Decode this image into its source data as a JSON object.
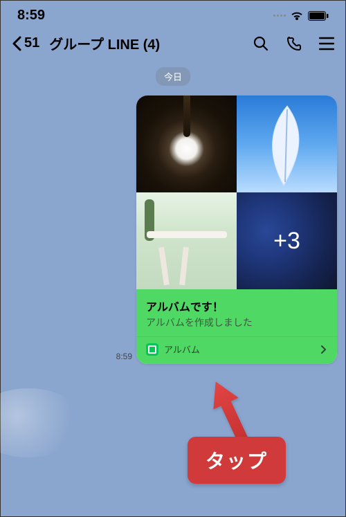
{
  "status": {
    "time": "8:59"
  },
  "header": {
    "back_count": "51",
    "title": "グループ LINE (4)"
  },
  "chat": {
    "date_label": "今日",
    "message_time": "8:59",
    "album": {
      "overflow_count": "+3",
      "title": "アルバムです！",
      "subtitle": "アルバムを作成しました",
      "footer_label": "アルバム"
    }
  },
  "annotation": {
    "label": "タップ"
  }
}
